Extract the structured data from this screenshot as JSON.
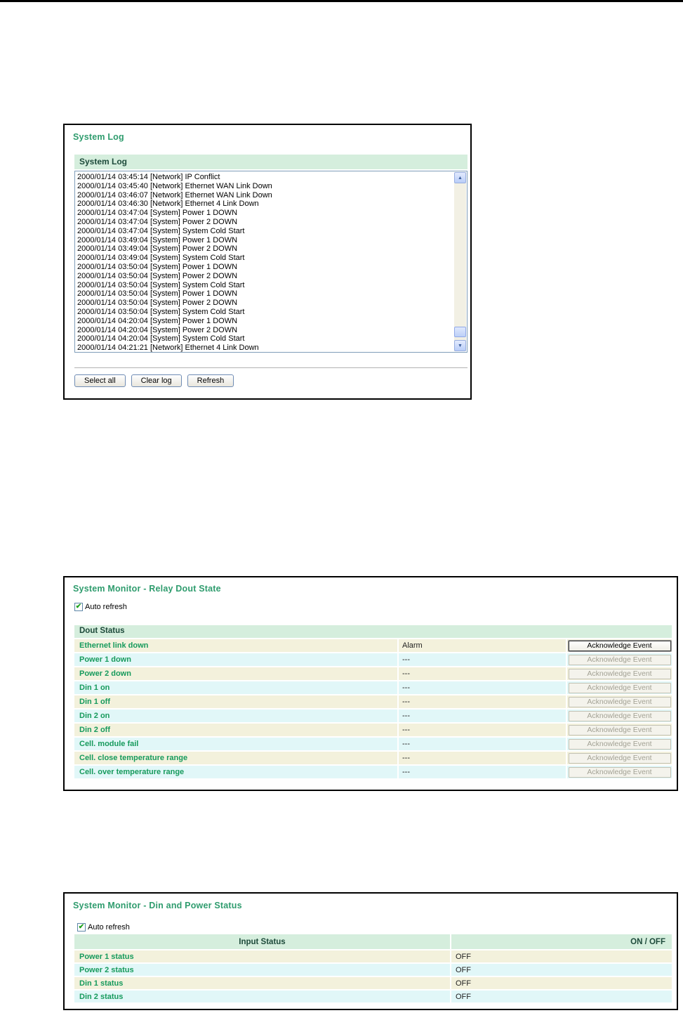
{
  "colors": {
    "title_green": "#2f9c6e",
    "label_green": "#169a5c",
    "section_header_bg": "#d5eedd",
    "section_header_text": "#1d4a3a",
    "row_beige": "#f3f1dc",
    "row_cyan": "#e1f7f8",
    "check_green": "#1ba11b"
  },
  "panel_system_log": {
    "title": "System Log",
    "section_header": "System Log",
    "log_entries": [
      "2000/01/14 03:45:14 [Network] IP Conflict",
      "2000/01/14 03:45:40 [Network] Ethernet WAN Link Down",
      "2000/01/14 03:46:07 [Network] Ethernet WAN Link Down",
      "2000/01/14 03:46:30 [Network] Ethernet 4 Link Down",
      "2000/01/14 03:47:04 [System] Power 1 DOWN",
      "2000/01/14 03:47:04 [System] Power 2 DOWN",
      "2000/01/14 03:47:04 [System] System Cold Start",
      "2000/01/14 03:49:04 [System] Power 1 DOWN",
      "2000/01/14 03:49:04 [System] Power 2 DOWN",
      "2000/01/14 03:49:04 [System] System Cold Start",
      "2000/01/14 03:50:04 [System] Power 1 DOWN",
      "2000/01/14 03:50:04 [System] Power 2 DOWN",
      "2000/01/14 03:50:04 [System] System Cold Start",
      "2000/01/14 03:50:04 [System] Power 1 DOWN",
      "2000/01/14 03:50:04 [System] Power 2 DOWN",
      "2000/01/14 03:50:04 [System] System Cold Start",
      "2000/01/14 04:20:04 [System] Power 1 DOWN",
      "2000/01/14 04:20:04 [System] Power 2 DOWN",
      "2000/01/14 04:20:04 [System] System Cold Start",
      "2000/01/14 04:21:21 [Network] Ethernet 4 Link Down"
    ],
    "buttons": {
      "select_all": "Select all",
      "clear_log": "Clear log",
      "refresh": "Refresh"
    }
  },
  "panel_relay_dout": {
    "title": "System Monitor - Relay Dout State",
    "auto_refresh_label": "Auto refresh",
    "auto_refresh_checked": true,
    "table_header": "Dout Status",
    "ack_button_label": "Acknowledge Event",
    "rows": [
      {
        "label": "Ethernet link down",
        "status": "Alarm",
        "enabled": true
      },
      {
        "label": "Power 1 down",
        "status": "---",
        "enabled": false
      },
      {
        "label": "Power 2 down",
        "status": "---",
        "enabled": false
      },
      {
        "label": "Din 1 on",
        "status": "---",
        "enabled": false
      },
      {
        "label": "Din 1 off",
        "status": "---",
        "enabled": false
      },
      {
        "label": "Din 2 on",
        "status": "---",
        "enabled": false
      },
      {
        "label": "Din 2 off",
        "status": "---",
        "enabled": false
      },
      {
        "label": "Cell. module fail",
        "status": "---",
        "enabled": false
      },
      {
        "label": "Cell. close temperature range",
        "status": "---",
        "enabled": false
      },
      {
        "label": "Cell. over temperature range",
        "status": "---",
        "enabled": false
      }
    ]
  },
  "panel_din_power": {
    "title": "System Monitor - Din and Power Status",
    "auto_refresh_label": "Auto refresh",
    "auto_refresh_checked": true,
    "columns": {
      "input_status": "Input Status",
      "on_off": "ON / OFF"
    },
    "rows": [
      {
        "label": "Power 1 status",
        "value": "OFF"
      },
      {
        "label": "Power 2 status",
        "value": "OFF"
      },
      {
        "label": "Din 1 status",
        "value": "OFF"
      },
      {
        "label": "Din 2 status",
        "value": "OFF"
      }
    ]
  }
}
